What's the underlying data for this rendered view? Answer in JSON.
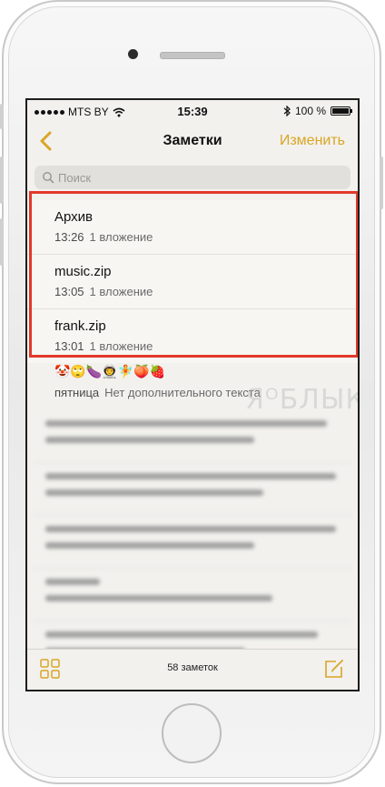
{
  "status_bar": {
    "carrier": "MTS BY",
    "time": "15:39",
    "battery": "100 %"
  },
  "nav": {
    "title": "Заметки",
    "edit_label": "Изменить",
    "accent_color": "#d9a625"
  },
  "search": {
    "placeholder": "Поиск"
  },
  "notes": [
    {
      "title": "Архив",
      "time": "13:26",
      "detail": "1 вложение"
    },
    {
      "title": "music.zip",
      "time": "13:05",
      "detail": "1 вложение"
    },
    {
      "title": "frank.zip",
      "time": "13:01",
      "detail": "1 вложение"
    }
  ],
  "emoji_note": {
    "emojis": "🤡🙄🍆👨‍🚀🧚🍑🍓",
    "time": "пятница",
    "detail": "Нет дополнительного текста"
  },
  "watermark": "ЯᴼБЛЫК",
  "toolbar": {
    "count_label": "58 заметок"
  },
  "highlight_color": "#e2382a"
}
